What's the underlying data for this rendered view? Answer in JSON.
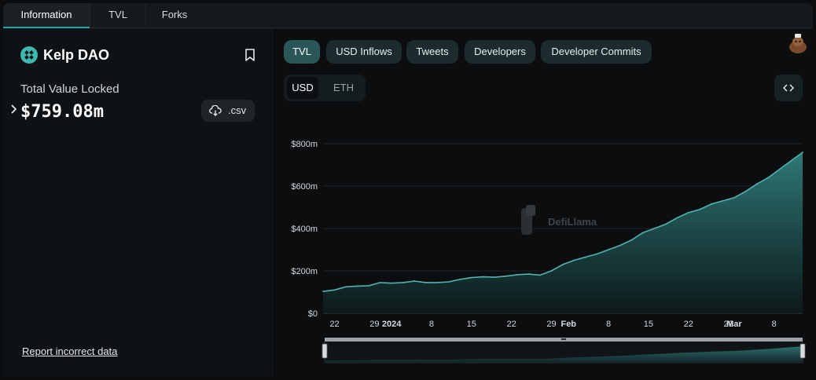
{
  "tabs": [
    {
      "label": "Information",
      "active": true
    },
    {
      "label": "TVL",
      "active": false
    },
    {
      "label": "Forks",
      "active": false
    }
  ],
  "protocol": {
    "name": "Kelp DAO",
    "tvl_label": "Total Value Locked",
    "tvl_value": "$759.08m",
    "csv_label": ".csv",
    "report_link": "Report incorrect data"
  },
  "metric_buttons": [
    {
      "label": "TVL",
      "active": true
    },
    {
      "label": "USD Inflows",
      "active": false
    },
    {
      "label": "Tweets",
      "active": false
    },
    {
      "label": "Developers",
      "active": false
    },
    {
      "label": "Developer Commits",
      "active": false
    }
  ],
  "denomination": [
    {
      "label": "USD",
      "active": true
    },
    {
      "label": "ETH",
      "active": false
    }
  ],
  "watermark": "DefiLlama",
  "colors": {
    "accent": "#3fb8af",
    "line": "#4fb3b0",
    "area_top": "#2f7e7c",
    "area_bottom": "#0d1a1b"
  },
  "icons": {
    "logo": "kelp-logo-icon",
    "bookmark": "bookmark-icon",
    "download": "cloud-download-icon",
    "embed": "code-embed-icon",
    "expand": "chevron-right-icon",
    "avatar": "llama-avatar-icon"
  },
  "chart_data": {
    "type": "area",
    "title": "",
    "xlabel": "",
    "ylabel": "",
    "ylim": [
      0,
      800
    ],
    "yunit": "$ millions",
    "y_ticks": [
      "$0",
      "$200m",
      "$400m",
      "$600m",
      "$800m"
    ],
    "x_ticks": [
      "22",
      "29",
      "2024",
      "8",
      "15",
      "22",
      "29",
      "Feb",
      "8",
      "15",
      "22",
      "29",
      "Mar",
      "8"
    ],
    "grid": true,
    "legend": "none",
    "series": [
      {
        "x": [
          "2023-12-20",
          "2023-12-22",
          "2023-12-24",
          "2023-12-26",
          "2023-12-28",
          "2023-12-30",
          "2024-01-01",
          "2024-01-03",
          "2024-01-05",
          "2024-01-07",
          "2024-01-09",
          "2024-01-11",
          "2024-01-13",
          "2024-01-15",
          "2024-01-17",
          "2024-01-19",
          "2024-01-21",
          "2024-01-23",
          "2024-01-25",
          "2024-01-27",
          "2024-01-29",
          "2024-01-31",
          "2024-02-02",
          "2024-02-04",
          "2024-02-06",
          "2024-02-08",
          "2024-02-10",
          "2024-02-12",
          "2024-02-14",
          "2024-02-16",
          "2024-02-18",
          "2024-02-20",
          "2024-02-22",
          "2024-02-24",
          "2024-02-26",
          "2024-02-28",
          "2024-03-01",
          "2024-03-03",
          "2024-03-05",
          "2024-03-07",
          "2024-03-09",
          "2024-03-11",
          "2024-03-13"
        ],
        "values": [
          103,
          110,
          125,
          128,
          130,
          145,
          142,
          145,
          152,
          145,
          145,
          148,
          160,
          168,
          172,
          170,
          175,
          182,
          185,
          180,
          200,
          230,
          250,
          265,
          280,
          300,
          320,
          345,
          380,
          400,
          420,
          450,
          475,
          490,
          515,
          530,
          545,
          575,
          610,
          640,
          680,
          720,
          759
        ]
      }
    ]
  }
}
